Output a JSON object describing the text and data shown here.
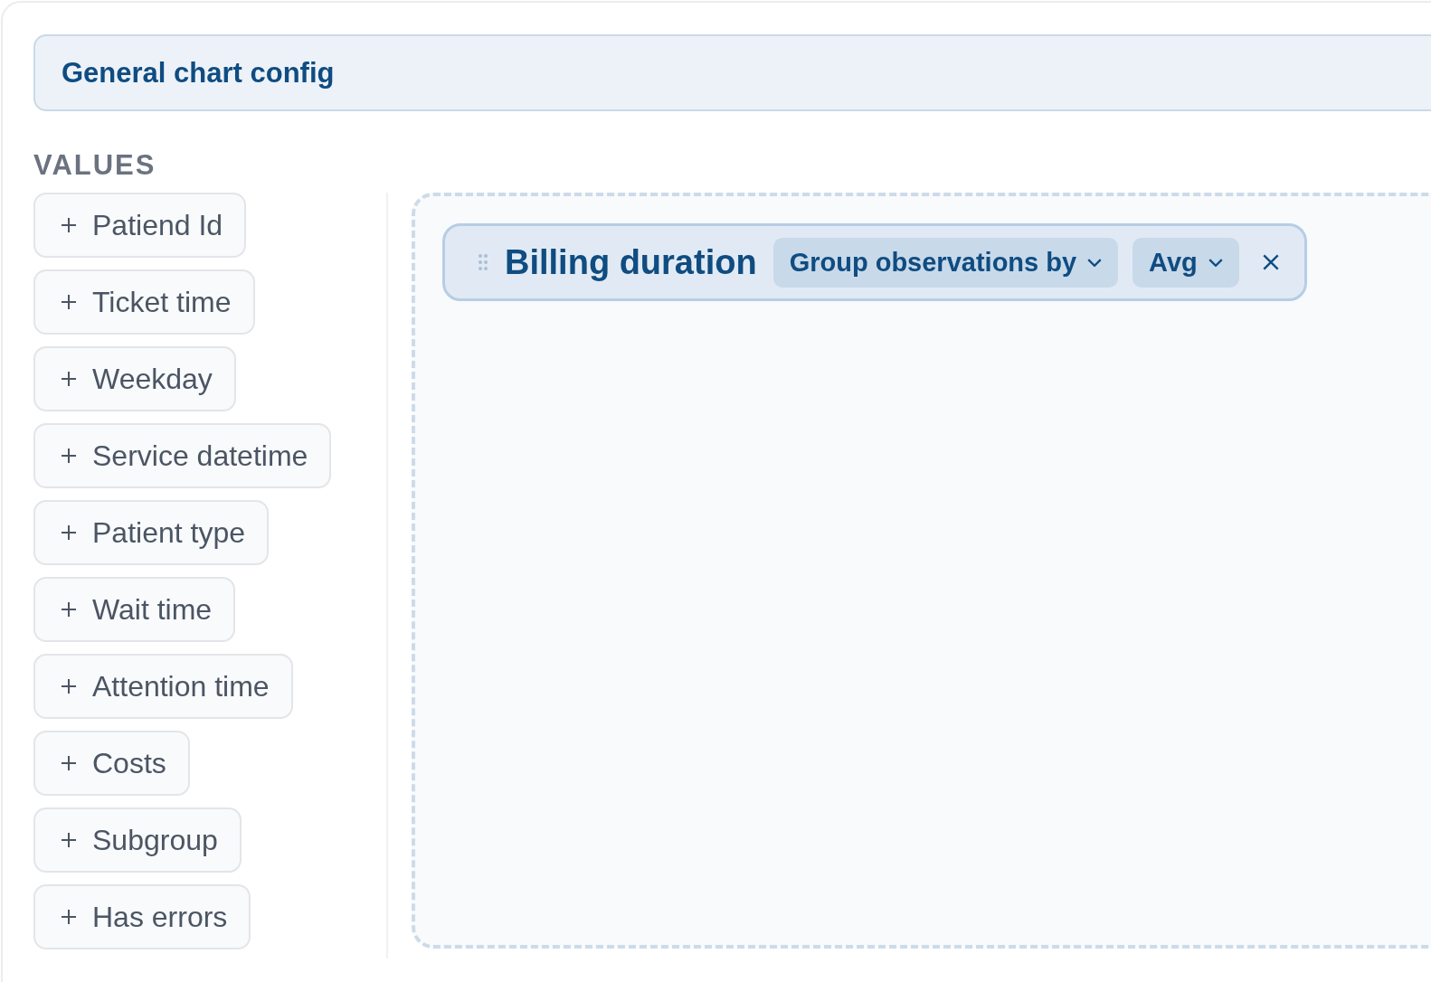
{
  "header": {
    "title": "General chart config"
  },
  "values": {
    "label": "VALUES",
    "items": [
      {
        "label": "Patiend Id"
      },
      {
        "label": "Ticket time"
      },
      {
        "label": "Weekday"
      },
      {
        "label": "Service datetime"
      },
      {
        "label": "Patient type"
      },
      {
        "label": "Wait time"
      },
      {
        "label": "Attention time"
      },
      {
        "label": "Costs"
      },
      {
        "label": "Subgroup"
      },
      {
        "label": "Has errors"
      }
    ]
  },
  "drop_zone": {
    "fields": [
      {
        "title": "Billing duration",
        "group_by": "Group observations by",
        "aggregation": "Avg"
      }
    ]
  }
}
